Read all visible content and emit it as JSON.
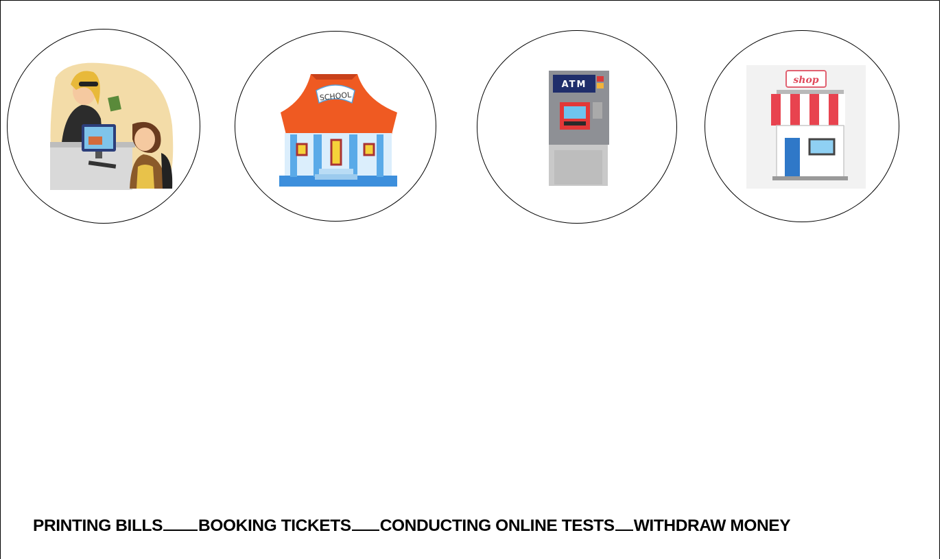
{
  "pictures": [
    {
      "name": "booking-counter"
    },
    {
      "name": "school",
      "sign_text": "SCHOOL"
    },
    {
      "name": "atm-machine",
      "sign_text": "ATM"
    },
    {
      "name": "shop",
      "sign_text": "shop"
    }
  ],
  "answer_options": [
    "PRINTING BILLS",
    "BOOKING TICKETS",
    "CONDUCTING ONLINE TESTS",
    "WITHDRAW MONEY"
  ]
}
